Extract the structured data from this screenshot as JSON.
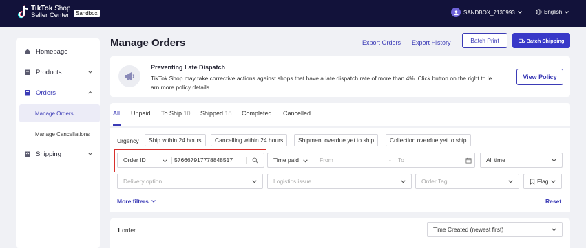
{
  "brand": {
    "line1_bold": "TikTok",
    "line1_rest": "Shop",
    "line2": "Seller Center",
    "env_badge": "Sandbox"
  },
  "account": {
    "name": "SANDBOX_7130993",
    "language": "English"
  },
  "sidebar": {
    "items": [
      {
        "label": "Homepage",
        "icon": "home-icon"
      },
      {
        "label": "Products",
        "icon": "products-icon"
      },
      {
        "label": "Orders",
        "icon": "orders-icon"
      },
      {
        "label": "Shipping",
        "icon": "shipping-icon"
      }
    ],
    "orders_sub": [
      "Manage Orders",
      "Manage Cancellations"
    ]
  },
  "header": {
    "title": "Manage Orders",
    "export_orders": "Export Orders",
    "export_history": "Export History",
    "batch_print": "Batch Print",
    "batch_shipping": "Batch Shipping"
  },
  "banner": {
    "title": "Preventing Late Dispatch",
    "text_line1": "TikTok Shop may take corrective actions against shops that have a late dispatch rate of more than 4%. Click button on the right to le",
    "text_line2": "arn more policy details.",
    "button": "View Policy"
  },
  "tabs": [
    {
      "label": "All",
      "count": ""
    },
    {
      "label": "Unpaid",
      "count": ""
    },
    {
      "label": "To Ship",
      "count": "10"
    },
    {
      "label": "Shipped",
      "count": "18"
    },
    {
      "label": "Completed",
      "count": ""
    },
    {
      "label": "Cancelled",
      "count": ""
    }
  ],
  "filters": {
    "urgency_label": "Urgency",
    "urgency_chips": [
      "Ship within 24 hours",
      "Cancelling within 24 hours",
      "Shipment overdue yet to ship",
      "Collection overdue yet to ship"
    ],
    "search_type": "Order ID",
    "search_value": "576667917778848517",
    "time_type": "Time paid",
    "from_placeholder": "From",
    "to_placeholder": "To",
    "time_range": "All time",
    "delivery_placeholder": "Delivery option",
    "logistics_placeholder": "Logistics issue",
    "order_tag_placeholder": "Order Tag",
    "flag": "Flag",
    "more_filters": "More filters",
    "reset": "Reset"
  },
  "results": {
    "count_number": "1",
    "count_label": "order",
    "sort": "Time Created (newest first)"
  },
  "colors": {
    "accent": "#3838c8",
    "topbar": "#12123a",
    "highlight": "#d9302c"
  }
}
